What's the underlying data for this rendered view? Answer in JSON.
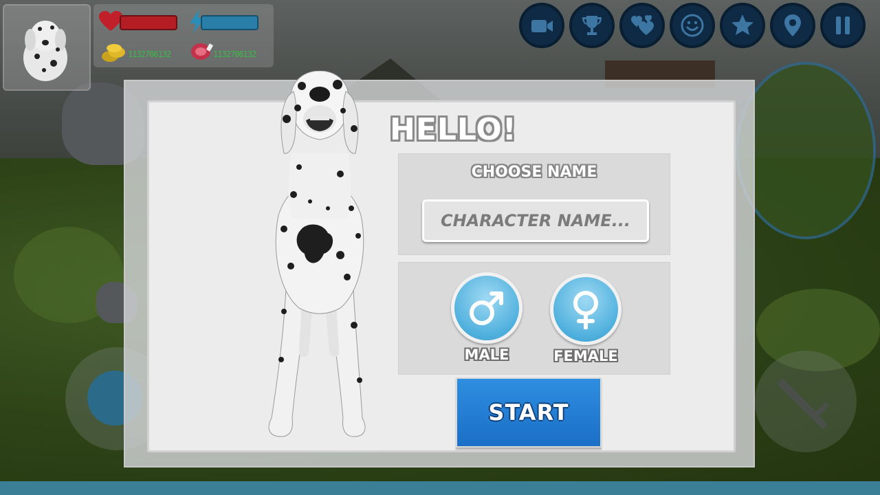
{
  "hud": {
    "coins": "1132706132",
    "meat": "1132706132",
    "health_color": "#c0202a",
    "energy_color": "#2a7fa8",
    "icons": [
      "camera-icon",
      "trophy-icon",
      "hearts-icon",
      "smiley-icon",
      "star-icon",
      "location-pin-icon",
      "pause-icon"
    ]
  },
  "dialog": {
    "title": "HELLO!",
    "name_section_label": "CHOOSE NAME",
    "name_placeholder": "CHARACTER NAME...",
    "name_value": "",
    "male_label": "MALE",
    "female_label": "FEMALE",
    "start_label": "START"
  },
  "colors": {
    "start_button": "#1f7ad3",
    "gender_button": "#5bb8e2"
  }
}
